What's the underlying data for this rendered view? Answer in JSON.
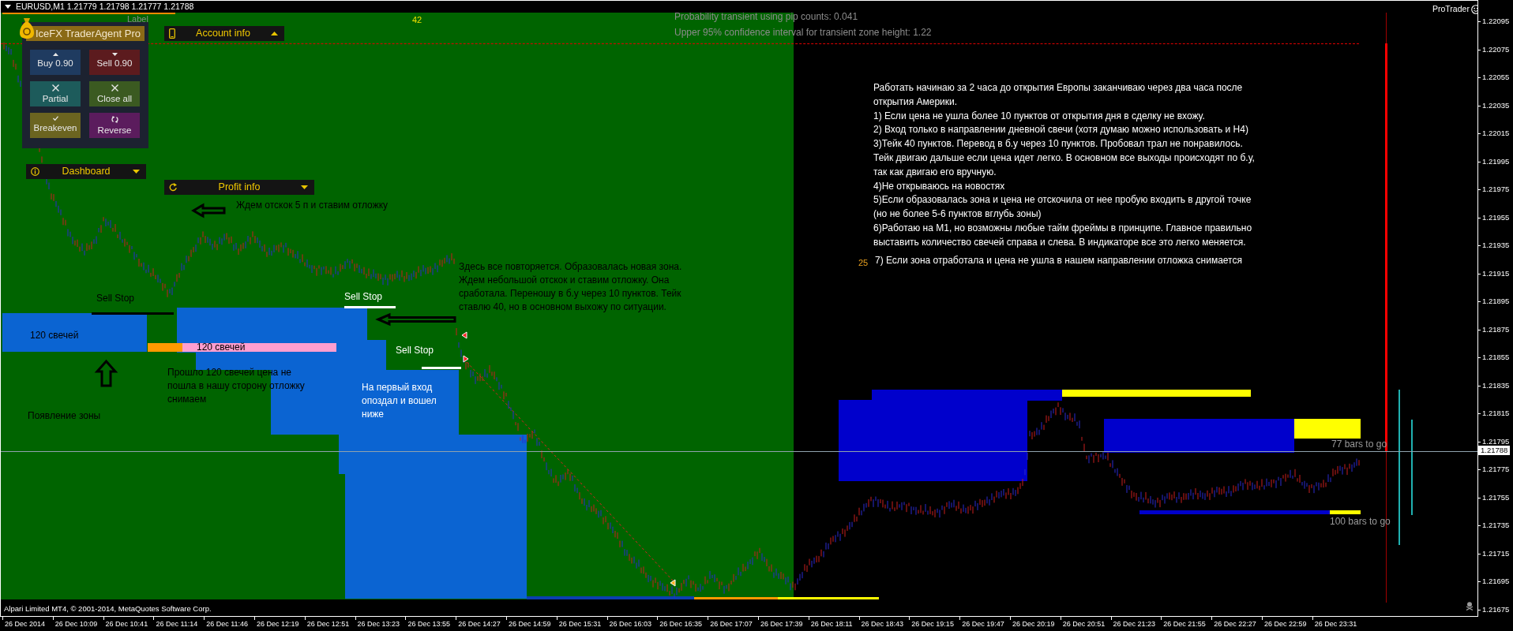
{
  "top_bar": {
    "symbol_quote": "EURUSD,M1  1.21779 1.21798 1.21777 1.21788",
    "overlay_label": "Label"
  },
  "trader_panel": {
    "title": "IceFX TraderAgent Pro",
    "buttons": [
      {
        "label": "Buy 0.90",
        "kind": "buy",
        "color": "#1f3b60"
      },
      {
        "label": "Sell 0.90",
        "kind": "sell",
        "color": "#5c1b1e"
      },
      {
        "label": "Partial",
        "kind": "close",
        "color": "#1d5b5b"
      },
      {
        "label": "Close all",
        "kind": "close",
        "color": "#3b5a21"
      },
      {
        "label": "Breakeven",
        "kind": "check",
        "color": "#6b6420"
      },
      {
        "label": "Reverse",
        "kind": "reverse",
        "color": "#5b1c5d"
      }
    ]
  },
  "widgets": [
    {
      "label": "Account info",
      "kind": "account",
      "expanded": true
    },
    {
      "label": "Dashboard",
      "kind": "info",
      "expanded": false
    },
    {
      "label": "Profit info",
      "kind": "profit",
      "expanded": false
    }
  ],
  "bar_counters": [
    "42",
    "25"
  ],
  "statistics": [
    "Probability transient using pip counts: 0.041",
    "Upper 95% confidence interval for transient zone height: 1.22"
  ],
  "annotations": [
    {
      "lines": [
        "Ждем отскок 5 п и ставим отложку"
      ]
    },
    {
      "lines": [
        "Здесь все повторяется. Образовалась новая зона.",
        "Ждем небольшой отскок и ставим отложку. Она",
        "сработала. Переношу в б.у через 10 пунктов. Тейк",
        "ставлю 40, но в основном выхожу по ситуации."
      ]
    },
    {
      "lines": [
        "Прошло 120 свечей цена не",
        "пошла в нашу сторону отложку",
        "снимаем"
      ]
    },
    {
      "lines": [
        "Появление зоны"
      ]
    },
    {
      "lines": [
        "На первый вход",
        "опоздал и вошел",
        "ниже"
      ]
    }
  ],
  "order_labels": [
    "Sell Stop",
    "Sell Stop",
    "Sell Stop"
  ],
  "zone_labels": [
    "120 свечей",
    "120 свечей"
  ],
  "countdowns": [
    "77 bars to go",
    "100 bars to go"
  ],
  "notes": {
    "paragraphs": [
      {
        "lines": [
          "Работать начинаю за 2 часа до открытия Европы заканчиваю через два часа после",
          "открытия Америки."
        ]
      },
      {
        "lines": [
          "1) Если цена не ушла более 10 пунктов от открытия дня в сделку не вхожу."
        ]
      },
      {
        "lines": [
          "2) Вход только в направлении дневной свечи (хотя думаю можно использовать и H4)"
        ]
      },
      {
        "lines": [
          "3)Тейк 40 пунктов. Перевод в б.у через 10 пунктов. Пробовал трал не понравилось.",
          "Тейк двигаю дальше если цена идет легко. В основном все выходы происходят по б.у,",
          "так как двигаю его вручную."
        ]
      },
      {
        "lines": [
          "4)Не открываюсь на новостях"
        ]
      },
      {
        "lines": [
          "5)Если образовалась зона и цена не отскочила от нее пробую входить в другой точке",
          "(но не более 5-6 пунктов вглубь зоны)"
        ]
      },
      {
        "lines": [
          "6)Работаю на M1, но возможны любые тайм фреймы в принципе. Главное правильно",
          "выставить количество свечей справа и слева. В индикаторе все это легко меняется."
        ]
      },
      {
        "lines": [
          "7) Если зона отработала и цена не ушла в нашем направлении отложка снимается"
        ]
      }
    ]
  },
  "brand": "ProTrader",
  "copyright": "Alpari Limited MT4, © 2001-2014, MetaQuotes Software Corp.",
  "price_axis": {
    "labels": [
      "1.22095",
      "1.22075",
      "1.22055",
      "1.22035",
      "1.22015",
      "1.21995",
      "1.21975",
      "1.21955",
      "1.21935",
      "1.21915",
      "1.21895",
      "1.21875",
      "1.21855",
      "1.21835",
      "1.21815",
      "1.21795",
      "1.21775",
      "1.21755",
      "1.21735",
      "1.21715",
      "1.21695",
      "1.21675"
    ],
    "current": "1.21788"
  },
  "time_axis": {
    "labels": [
      "26 Dec 2014",
      "26 Dec 10:09",
      "26 Dec 10:41",
      "26 Dec 11:14",
      "26 Dec 11:46",
      "26 Dec 12:19",
      "26 Dec 12:51",
      "26 Dec 13:23",
      "26 Dec 13:55",
      "26 Dec 14:27",
      "26 Dec 14:59",
      "26 Dec 15:31",
      "26 Dec 16:03",
      "26 Dec 16:35",
      "26 Dec 17:07",
      "26 Dec 17:39",
      "26 Dec 18:11",
      "26 Dec 18:43",
      "26 Dec 19:15",
      "26 Dec 19:47",
      "26 Dec 20:19",
      "26 Dec 20:51",
      "26 Dec 21:23",
      "26 Dec 21:55",
      "26 Dec 22:27",
      "26 Dec 22:59",
      "26 Dec 23:31"
    ]
  }
}
